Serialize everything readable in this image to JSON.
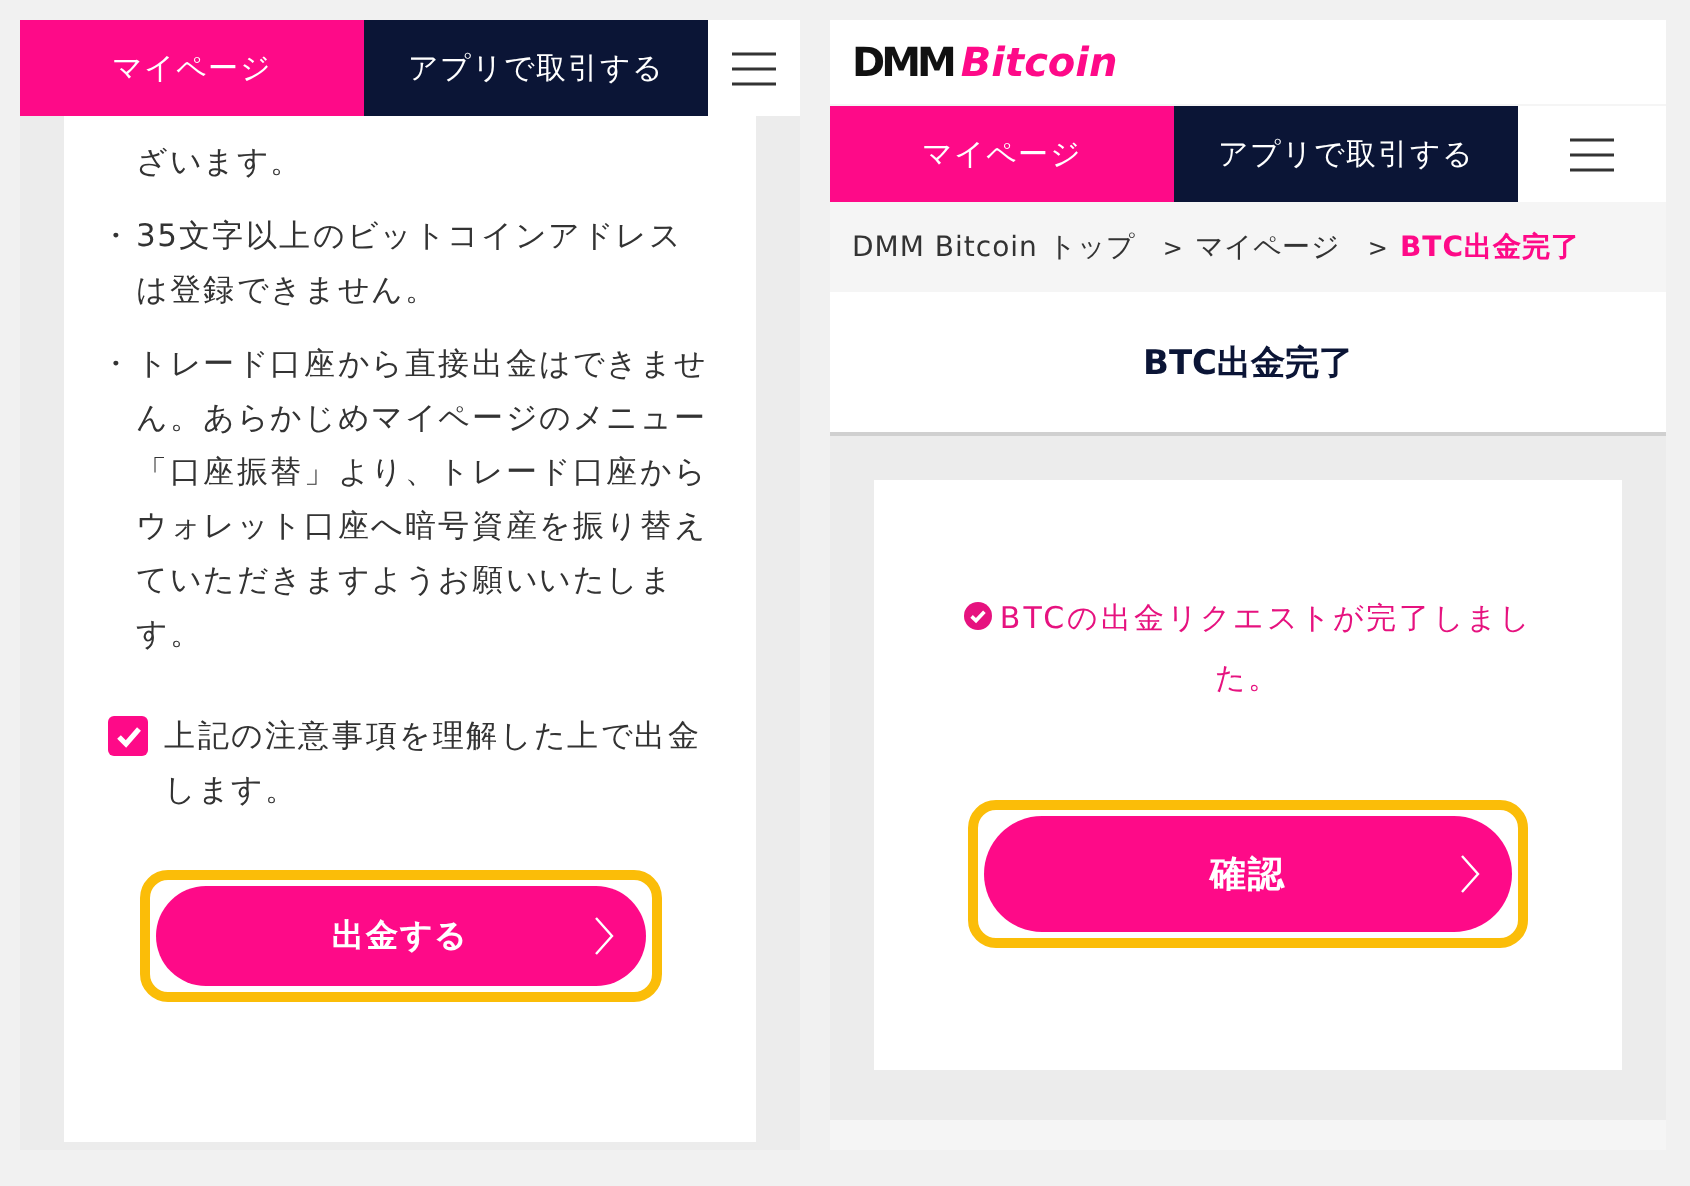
{
  "left_screen": {
    "nav": {
      "tabs": [
        {
          "label": "マイページ",
          "selected": true
        },
        {
          "label": "アプリで取引する",
          "selected": false
        }
      ]
    },
    "notes": [
      "ざいます。",
      "35文字以上のビットコインアドレスは登録できません。",
      "トレード口座から直接出金はできません。あらかじめマイページのメニュー「口座振替」より、トレード口座からウォレット口座へ暗号資産を振り替えていただきますようお願いいたします。"
    ],
    "bullet": "・",
    "agreement": {
      "label": "上記の注意事項を理解した上で出金します。",
      "checked": true
    },
    "submit_button": {
      "label": "出金する",
      "highlighted": true
    }
  },
  "right_screen": {
    "logo": {
      "part_1": "DMM",
      "part_2": "Bitcoin"
    },
    "nav": {
      "tabs": [
        {
          "label": "マイページ",
          "selected": true
        },
        {
          "label": "アプリで取引する",
          "selected": false
        }
      ]
    },
    "breadcrumb": [
      {
        "label": "DMM Bitcoin トップ",
        "current": false
      },
      {
        "label": "マイページ",
        "current": false
      },
      {
        "label": "BTC出金完了",
        "current": true
      }
    ],
    "breadcrumb_separator": ">",
    "title": "BTC出金完了",
    "message": "BTCの出金リクエストが完了しました。",
    "confirm_button": {
      "label": "確認",
      "highlighted": true
    }
  }
}
